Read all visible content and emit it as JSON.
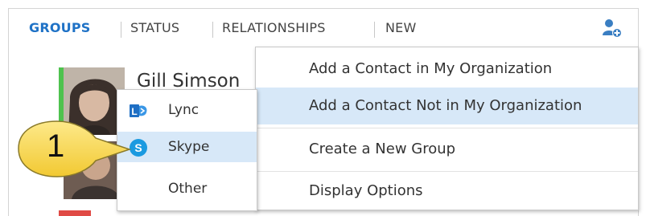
{
  "nav": {
    "tabs": [
      {
        "label": "GROUPS",
        "active": true
      },
      {
        "label": "STATUS",
        "active": false
      },
      {
        "label": "RELATIONSHIPS",
        "active": false
      },
      {
        "label": "NEW",
        "active": false
      }
    ],
    "add_contact_icon": "add-contact-icon"
  },
  "contact": {
    "name": "Gill Simson",
    "presence_color": "#4ec24e"
  },
  "add_contact_menu": {
    "items": [
      {
        "label": "Add a Contact in My Organization",
        "highlighted": false
      },
      {
        "label": "Add a Contact Not in My Organization",
        "highlighted": true
      },
      {
        "label": "Create a New Group",
        "highlighted": false
      },
      {
        "label": "Display Options",
        "highlighted": false
      }
    ]
  },
  "submenu": {
    "items": [
      {
        "label": "Lync",
        "icon": "lync-icon",
        "highlighted": false
      },
      {
        "label": "Skype",
        "icon": "skype-icon",
        "highlighted": true
      },
      {
        "label": "Other",
        "icon": "",
        "highlighted": false
      }
    ]
  },
  "callout": {
    "number": "1",
    "color": "#f7d748"
  },
  "colors": {
    "accent": "#1f72c6",
    "highlight": "#d7e8f8"
  }
}
